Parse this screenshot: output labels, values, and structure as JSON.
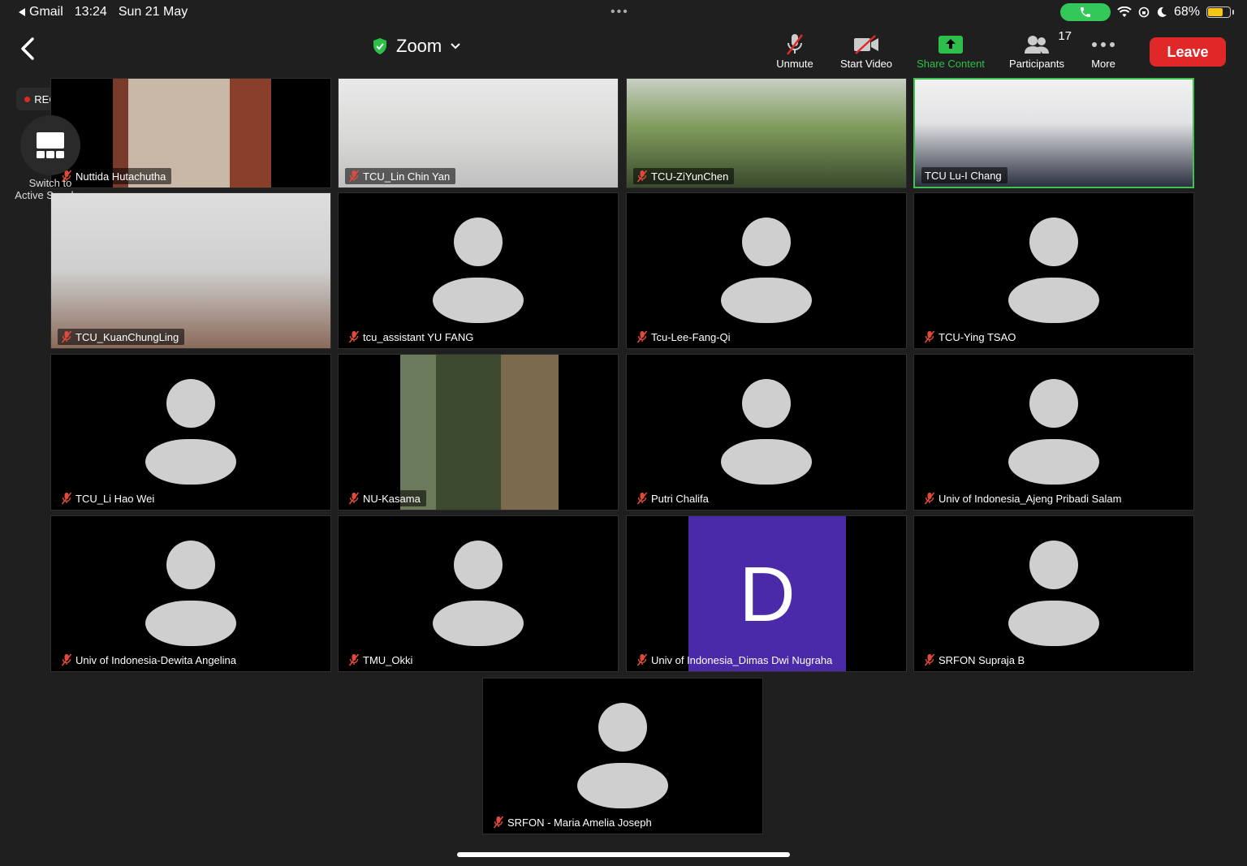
{
  "status_bar": {
    "back_app": "Gmail",
    "time": "13:24",
    "date": "Sun 21 May",
    "battery": "68%",
    "battery_level": 0.68,
    "dots": "•••"
  },
  "toolbar": {
    "title": "Zoom",
    "buttons": {
      "unmute": "Unmute",
      "start_video": "Start Video",
      "share_content": "Share Content",
      "participants": "Participants",
      "participants_count": "17",
      "more": "More"
    },
    "leave": "Leave"
  },
  "rec_label": "REC",
  "switch_label_line1": "Switch to",
  "switch_label_line2": "Active Speaker",
  "colors": {
    "accent_green": "#2dbf4a",
    "leave_red": "#e02828",
    "active_border": "#3ec34c",
    "letter_avatar_bg": "#4a2aa8"
  },
  "participants": [
    {
      "name": "Nuttida Hutachutha",
      "video": true,
      "muted": true
    },
    {
      "name": "TCU_Lin Chin Yan",
      "video": true,
      "muted": true
    },
    {
      "name": "TCU-ZiYunChen",
      "video": true,
      "muted": true
    },
    {
      "name": "TCU Lu-I Chang",
      "video": true,
      "muted": false,
      "active": true
    },
    {
      "name": "TCU_KuanChungLing",
      "video": true,
      "muted": true
    },
    {
      "name": "tcu_assistant YU FANG",
      "video": false,
      "muted": true
    },
    {
      "name": "Tcu-Lee-Fang-Qi",
      "video": false,
      "muted": true
    },
    {
      "name": "TCU-Ying TSAO",
      "video": false,
      "muted": true
    },
    {
      "name": "TCU_Li Hao Wei",
      "video": false,
      "muted": true
    },
    {
      "name": "NU-Kasama",
      "video": true,
      "muted": true
    },
    {
      "name": "Putri Chalifa",
      "video": false,
      "muted": true
    },
    {
      "name": "Univ of Indonesia_Ajeng Pribadi Salam",
      "video": false,
      "muted": true
    },
    {
      "name": "Univ of Indonesia-Dewita Angelina",
      "video": false,
      "muted": true
    },
    {
      "name": "TMU_Okki",
      "video": false,
      "muted": true
    },
    {
      "name": "Univ of Indonesia_Dimas Dwi Nugraha",
      "video": false,
      "muted": true,
      "letter": "D"
    },
    {
      "name": "SRFON Supraja B",
      "video": false,
      "muted": true
    },
    {
      "name": "SRFON - Maria Amelia Joseph",
      "video": false,
      "muted": true
    }
  ]
}
